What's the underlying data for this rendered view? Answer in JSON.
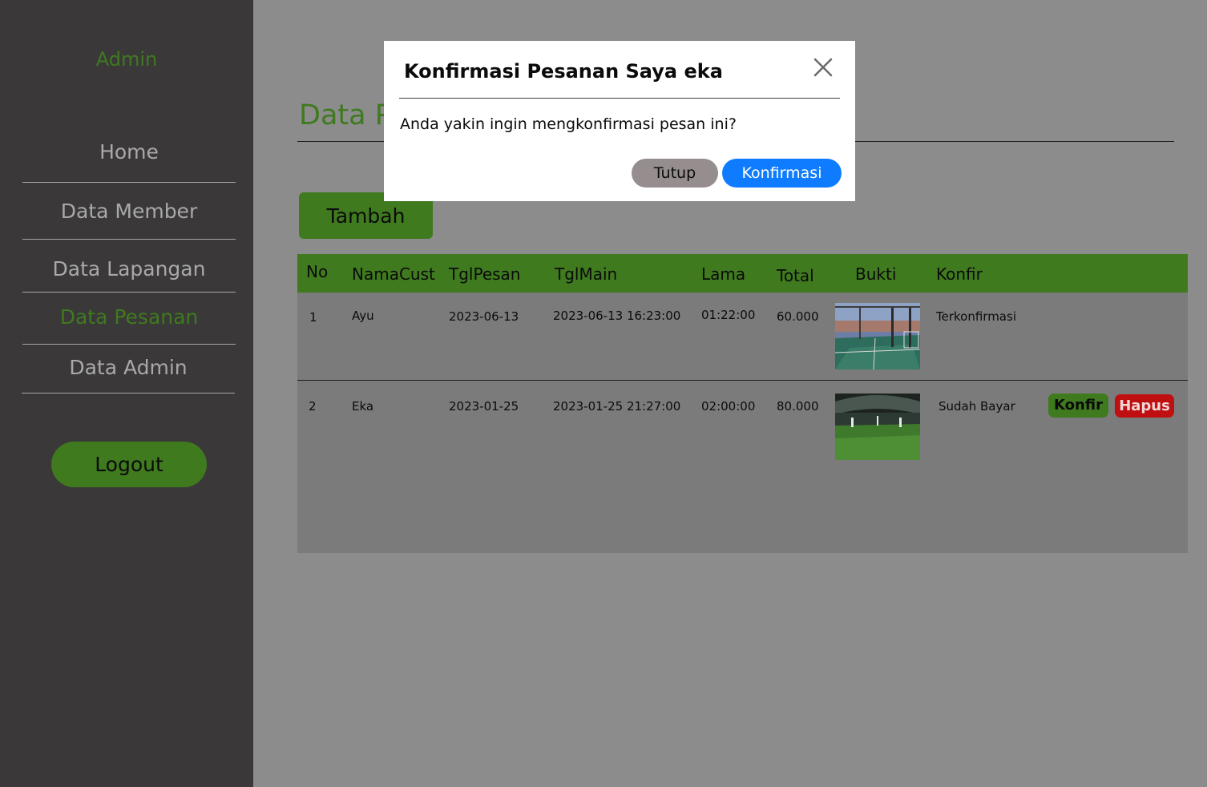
{
  "sidebar": {
    "brand": "Admin",
    "items": [
      {
        "label": "Home"
      },
      {
        "label": "Data Member"
      },
      {
        "label": "Data Lapangan"
      },
      {
        "label": "Data Pesanan",
        "active": true
      },
      {
        "label": "Data Admin"
      }
    ],
    "logout_label": "Logout"
  },
  "main": {
    "title": "Data Pesanan",
    "add_label": "Tambah",
    "table": {
      "headers": [
        "No",
        "NamaCust",
        "TglPesan",
        "TglMain",
        "Lama",
        "Total",
        "Bukti",
        "Konfir"
      ],
      "rows": [
        {
          "no": "1",
          "nama": "Ayu",
          "tgl_pesan": "2023-06-13",
          "tgl_main": "2023-06-13 16:23:00",
          "lama": "01:22:00",
          "total": "60.000",
          "bukti_icon": "futsal-court-photo",
          "status": "Terkonfirmasi"
        },
        {
          "no": "2",
          "nama": "Eka",
          "tgl_pesan": "2023-01-25",
          "tgl_main": "2023-01-25 21:27:00",
          "lama": "02:00:00",
          "total": "80.000",
          "bukti_icon": "indoor-field-photo",
          "status": "Sudah Bayar",
          "konfir_label": "Konfir",
          "hapus_label": "Hapus"
        }
      ]
    }
  },
  "modal": {
    "title": "Konfirmasi Pesanan Saya eka",
    "body": "Anda yakin ingin mengkonfirmasi pesan ini?",
    "close_label": "Tutup",
    "confirm_label": "Konfirmasi",
    "close_icon": "close-icon"
  },
  "colors": {
    "sidebar_bg": "#3a3839",
    "accent_green": "#3f7a1f",
    "overlay_bg": "#8c8c8c",
    "primary_blue": "#0f7cff",
    "danger_red": "#c00f10",
    "secondary_gray": "#968e8e"
  }
}
